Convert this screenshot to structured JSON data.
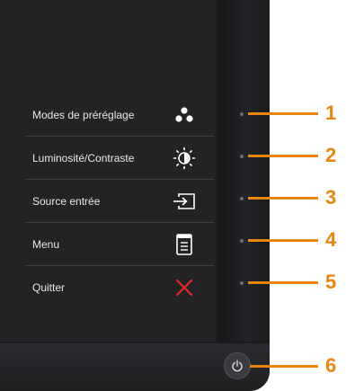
{
  "menu": {
    "items": [
      {
        "label": "Modes de préréglage",
        "icon": "preset-modes-icon"
      },
      {
        "label": "Luminosité/Contraste",
        "icon": "brightness-contrast-icon"
      },
      {
        "label": "Source entrée",
        "icon": "input-source-icon"
      },
      {
        "label": "Menu",
        "icon": "menu-icon"
      },
      {
        "label": "Quitter",
        "icon": "exit-icon"
      }
    ]
  },
  "callouts": [
    "1",
    "2",
    "3",
    "4",
    "5",
    "6"
  ],
  "colors": {
    "accent": "#e8850f",
    "exit": "#e8242c",
    "bezel": "#1b1c1e",
    "screen": "#232326",
    "text": "#e8e8e8"
  }
}
